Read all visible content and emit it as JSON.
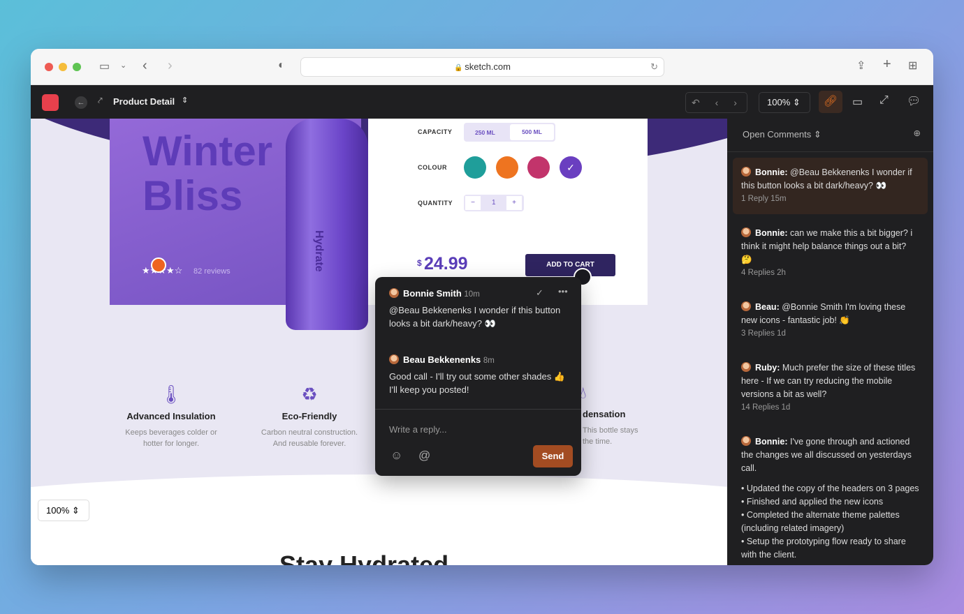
{
  "browser": {
    "url": "sketch.com"
  },
  "toolbar": {
    "doc_title": "Product Detail",
    "zoom": "100%"
  },
  "product": {
    "title_line1": "Winter",
    "title_line2": "Bliss",
    "brand": "Hydrate",
    "reviews": "82 reviews",
    "rating": 4.5,
    "capacity_label": "CAPACITY",
    "capacity_options": [
      "250 ML",
      "500 ML"
    ],
    "colour_label": "COLOUR",
    "colours": [
      "#1f9e9a",
      "#ee7420",
      "#c2346b",
      "#6a3fc0"
    ],
    "quantity_label": "QUANTITY",
    "quantity": "1",
    "currency": "$",
    "price": "24.99",
    "add_to_cart": "ADD TO CART"
  },
  "features": [
    {
      "title": "Advanced Insulation",
      "desc1": "Keeps beverages colder or",
      "desc2": "hotter for longer."
    },
    {
      "title": "Eco-Friendly",
      "desc1": "Carbon neutral construction.",
      "desc2": "And reusable forever."
    },
    {
      "title": "densation",
      "desc1": "This bottle stays",
      "desc2": "the time."
    }
  ],
  "section_heading": "Stay Hydrated",
  "canvas_zoom": "100%",
  "popup": {
    "c1_author": "Bonnie Smith",
    "c1_time": "10m",
    "c1_text": "@Beau Bekkenenks I wonder if this button looks a bit dark/heavy? 👀",
    "c2_author": "Beau Bekkenenks",
    "c2_time": "8m",
    "c2_text": "Good call - I'll try out some other shades 👍 I'll keep you posted!",
    "reply_placeholder": "Write a reply...",
    "send": "Send"
  },
  "sidebar": {
    "filter": "Open Comments",
    "comments": [
      {
        "author": "Bonnie:",
        "text": "@Beau Bekkenenks I won­der if this button looks a bit dark/heavy? 👀",
        "meta": "1 Reply  15m"
      },
      {
        "author": "Bonnie:",
        "text": "can we make this a bit big­ger? i think it might help balance things out a bit? 🤔",
        "meta": "4 Replies  2h"
      },
      {
        "author": "Beau:",
        "text": "@Bonnie Smith I'm loving these new icons - fantastic job! 👏",
        "meta": "3 Replies  1d"
      },
      {
        "author": "Ruby:",
        "text": "Much prefer the size of these titles here - If we can try reducing the mobile versions a bit as well?",
        "meta": "14 Replies  1d"
      },
      {
        "author": "Bonnie:",
        "text": "I've gone through and actio­ned the changes we all discussed on yesterdays call.",
        "meta": ""
      }
    ],
    "bullets": [
      "• Updated the copy of the headers on 3 pages",
      "• Finished and applied the new icons",
      "• Completed the alternate theme palettes (including related imagery)",
      "• Setup the prototyping flow ready to share with the client."
    ]
  }
}
